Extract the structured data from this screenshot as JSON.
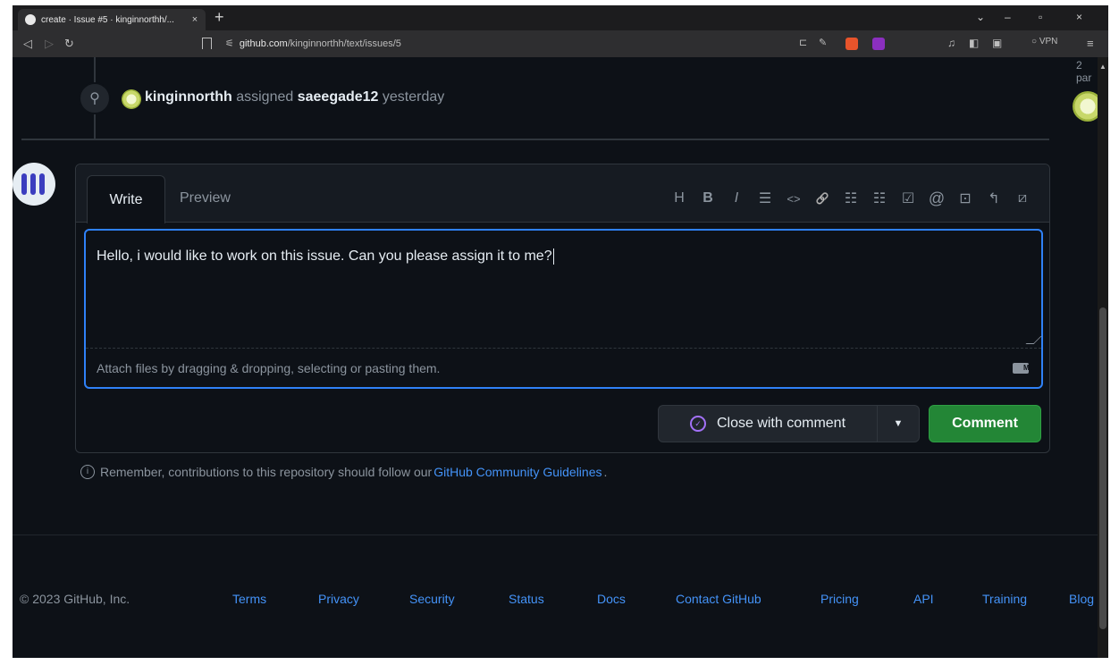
{
  "browser": {
    "tab_title": "create · Issue #5 · kinginnorthh/...",
    "tab_close": "×",
    "new_tab": "+",
    "url_prefix": "github.com",
    "url_path": "/kinginnorthh/text/issues/5",
    "vpn_label": "VPN",
    "window_controls": [
      "⌄",
      "–",
      "▫",
      "×"
    ]
  },
  "page_top_text": "2 par",
  "timeline_event": {
    "actor": "kinginnorthh",
    "action": "assigned",
    "assignee": "saeegade12",
    "time": "yesterday"
  },
  "composer": {
    "tab_write": "Write",
    "tab_preview": "Preview",
    "toolbar": [
      {
        "icon": "heading-icon",
        "glyph": "H"
      },
      {
        "icon": "bold-icon",
        "glyph": "B"
      },
      {
        "icon": "italic-icon",
        "glyph": "I"
      },
      {
        "icon": "quote-icon",
        "glyph": "☰"
      },
      {
        "icon": "code-icon",
        "glyph": "<>"
      },
      {
        "icon": "link-icon",
        "glyph": "🔗"
      },
      {
        "icon": "bullet-list-icon",
        "glyph": "☷"
      },
      {
        "icon": "numbered-list-icon",
        "glyph": "☷"
      },
      {
        "icon": "task-list-icon",
        "glyph": "☑"
      },
      {
        "icon": "mention-icon",
        "glyph": "@"
      },
      {
        "icon": "reference-icon",
        "glyph": "⊡"
      },
      {
        "icon": "reply-icon",
        "glyph": "↰"
      },
      {
        "icon": "slash-command-icon",
        "glyph": "⧄"
      }
    ],
    "text": "Hello, i would like to work on this issue. Can you please assign it to me?",
    "attach_hint": "Attach files by dragging & dropping, selecting or pasting them.",
    "md_badge": "M↓",
    "close_button": "Close with comment",
    "comment_button": "Comment"
  },
  "remember": {
    "prefix": "Remember, contributions to this repository should follow our",
    "link": "GitHub Community Guidelines",
    "suffix": "."
  },
  "footer": {
    "copyright": "© 2023 GitHub, Inc.",
    "links": [
      "Terms",
      "Privacy",
      "Security",
      "Status",
      "Docs",
      "Contact GitHub",
      "Pricing",
      "API",
      "Training",
      "Blog"
    ]
  },
  "colors": {
    "background": "#0d1117",
    "accent_blue": "#2f81f7",
    "link_blue": "#4493f8",
    "comment_green": "#238636",
    "close_purple": "#a371f7"
  }
}
